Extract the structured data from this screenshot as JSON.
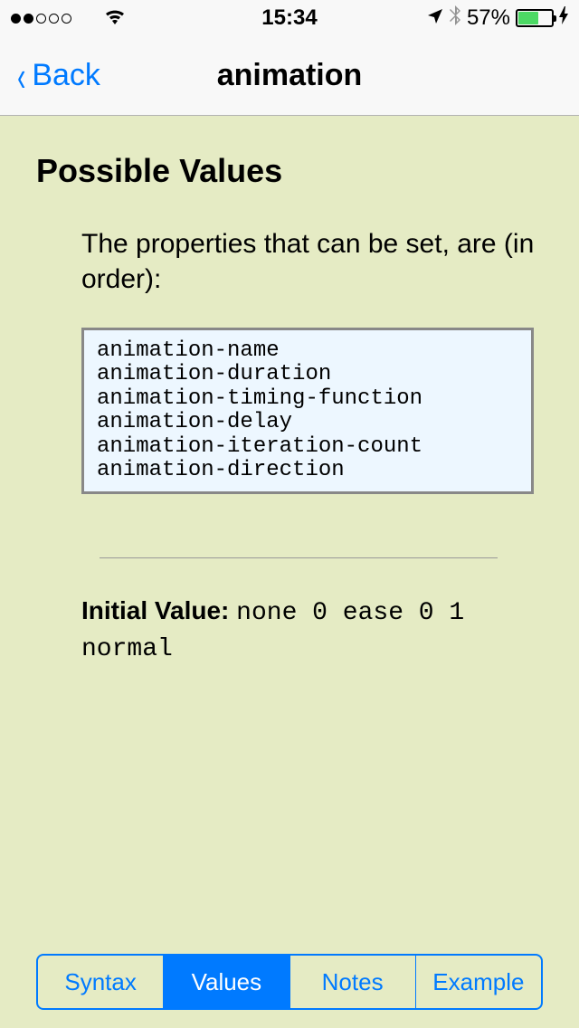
{
  "status": {
    "time": "15:34",
    "battery_percent": "57%",
    "carrier_dots_filled": 2,
    "carrier_dots_total": 5
  },
  "nav": {
    "back_label": "Back",
    "title": "animation"
  },
  "content": {
    "section_title": "Possible Values",
    "description": "The properties that can be set, are (in order):",
    "code_lines": [
      "animation-name",
      "animation-duration",
      "animation-timing-function",
      "animation-delay",
      "animation-iteration-count",
      "animation-direction"
    ],
    "initial_label": "Initial Value:",
    "initial_value": "none 0 ease 0 1 normal"
  },
  "tabs": [
    {
      "label": "Syntax",
      "active": false
    },
    {
      "label": "Values",
      "active": true
    },
    {
      "label": "Notes",
      "active": false
    },
    {
      "label": "Example",
      "active": false
    }
  ]
}
